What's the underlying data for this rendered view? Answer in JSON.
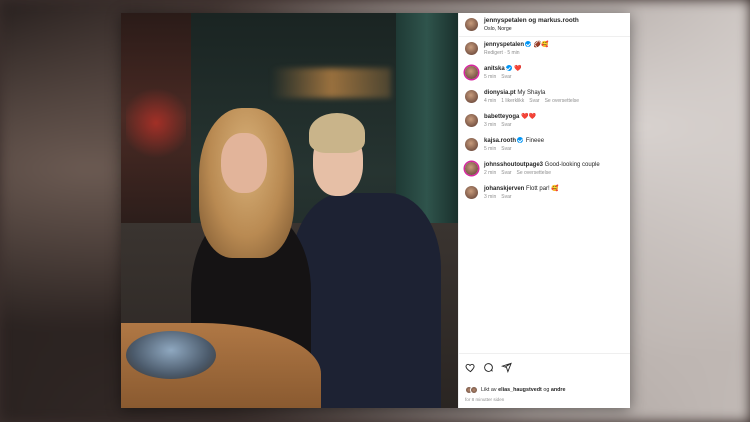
{
  "post": {
    "header": {
      "authors": "jennyspetalen og markus.rooth",
      "location": "Oslo, Norge"
    },
    "comments": [
      {
        "user": "jennyspetalen",
        "verified": true,
        "text": "🏈🥰",
        "meta": [
          "Redigert · 5 min"
        ]
      },
      {
        "user": "anitska",
        "verified": true,
        "text": "❤️",
        "meta": [
          "5 min",
          "Svar"
        ]
      },
      {
        "user": "dionysia.pt",
        "verified": false,
        "text": "My Shayla",
        "meta": [
          "4 min",
          "1 likerklikk",
          "Svar",
          "Se oversettelse"
        ]
      },
      {
        "user": "babetteyoga",
        "verified": false,
        "text": "❤️❤️",
        "meta": [
          "3 min",
          "Svar"
        ]
      },
      {
        "user": "kajsa.rooth",
        "verified": true,
        "text": "Fineee",
        "meta": [
          "5 min",
          "Svar"
        ]
      },
      {
        "user": "johnsshoutoutpage3",
        "verified": false,
        "text": "Good-looking couple",
        "meta": [
          "2 min",
          "Svar",
          "Se oversettelse"
        ]
      },
      {
        "user": "johanskjerven",
        "verified": false,
        "text": "Flott par! 🥰",
        "meta": [
          "3 min",
          "Svar"
        ]
      }
    ],
    "actions": {
      "like_icon": "heart-icon",
      "comment_icon": "comment-icon",
      "share_icon": "send-icon"
    },
    "likes": {
      "prefix": "Likt av",
      "user": "elias_haugstvedt",
      "joiner": "og",
      "others": "andre"
    },
    "timestamp": "for 8 minutter siden",
    "colors": {
      "verified": "#0095f6",
      "text": "#262626",
      "muted": "#8e8e8e"
    }
  }
}
